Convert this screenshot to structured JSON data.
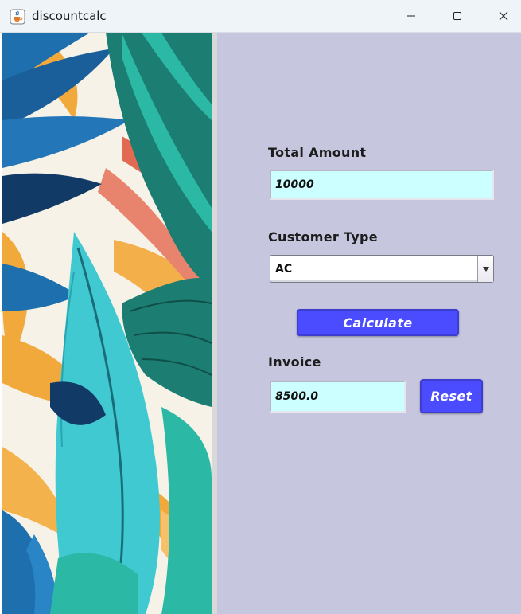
{
  "window": {
    "title": "discountcalc",
    "app_icon": "java-cup-icon",
    "minimize_icon": "minimize-icon",
    "maximize_icon": "maximize-icon",
    "close_icon": "close-icon"
  },
  "decor": {
    "image": "tropical-leaves-illustration",
    "colors": {
      "teal": "#2bb9a6",
      "dark_teal": "#1c7d72",
      "cyan": "#40c9d0",
      "blue": "#1e6fae",
      "navy": "#123a66",
      "orange": "#f2a93b",
      "coral": "#e26a52"
    }
  },
  "form": {
    "background": "#c7c6df",
    "total_amount_label": "Total Amount",
    "total_amount_value": "10000",
    "customer_type_label": "Customer Type",
    "customer_type_selected": "AC",
    "calculate_label": "Calculate",
    "invoice_label": "Invoice",
    "invoice_value": "8500.0",
    "reset_label": "Reset",
    "field_color": "#ccffff",
    "button_color": "#4b4bff"
  }
}
